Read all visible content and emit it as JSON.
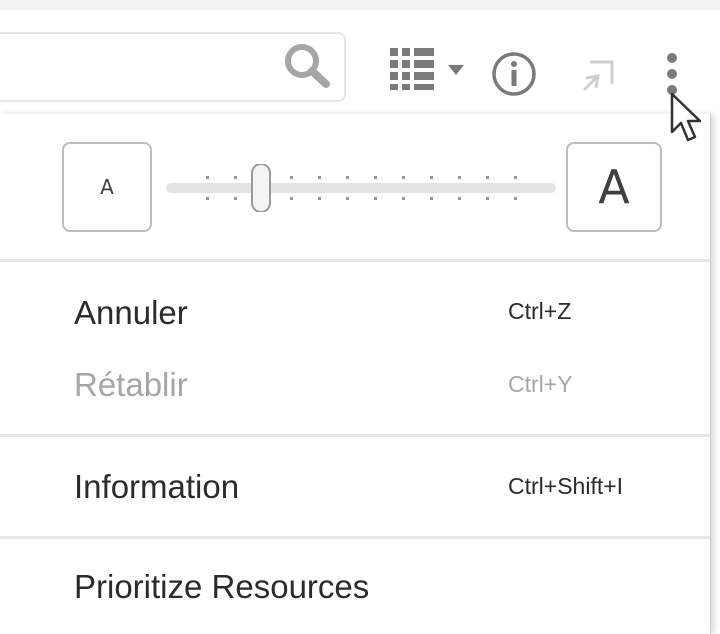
{
  "font_size": {
    "small_label": "A",
    "large_label": "A",
    "slider_level": 0.25
  },
  "menu": {
    "items": [
      {
        "label": "Annuler",
        "shortcut": "Ctrl+Z",
        "enabled": true
      },
      {
        "label": "Rétablir",
        "shortcut": "Ctrl+Y",
        "enabled": false
      },
      {
        "label": "Information",
        "shortcut": "Ctrl+Shift+I",
        "enabled": true
      },
      {
        "label": "Prioritize Resources",
        "shortcut": "",
        "enabled": true
      }
    ]
  },
  "icons": {
    "search": "search-icon",
    "view": "grid-view-icon",
    "info": "info-icon",
    "expand": "expand-icon",
    "more": "more-vertical-icon"
  },
  "colors": {
    "icon": "#a6a6a6",
    "text": "#2b2b2b",
    "disabled_text": "#a6a6a6"
  }
}
